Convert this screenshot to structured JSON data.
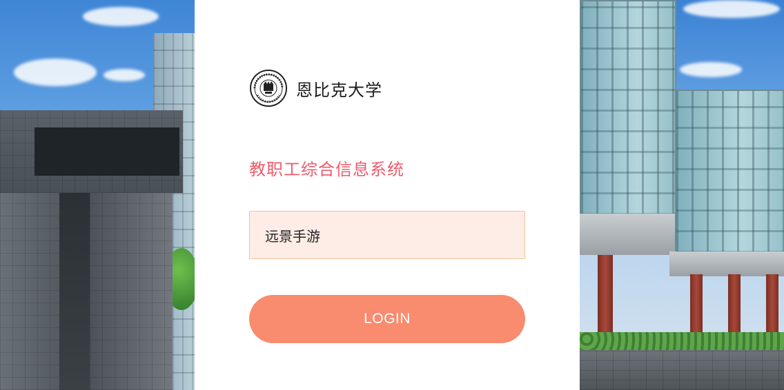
{
  "brand": {
    "name": "恩比克大学",
    "seal_icon": "university-seal-icon"
  },
  "login": {
    "system_title": "教职工综合信息系统",
    "account_value": "远景手游",
    "button_label": "LOGIN"
  },
  "colors": {
    "title_accent": "#ef5b6b",
    "button_bg": "#f98b6e",
    "input_bg": "#fdede6",
    "input_border": "#f0c49b",
    "panel_bg": "#ffffff"
  }
}
